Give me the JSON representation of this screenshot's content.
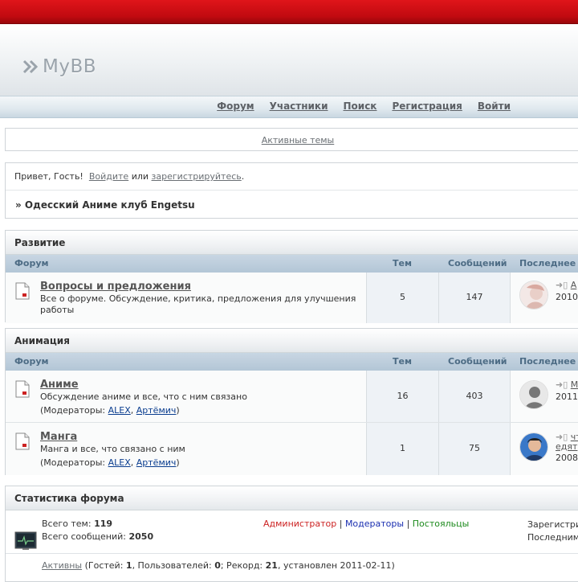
{
  "header": {
    "logo_text": "MyBB"
  },
  "menu": {
    "forum": "Форум",
    "members": "Участники",
    "search": "Поиск",
    "register": "Регистрация",
    "login": "Войти"
  },
  "active_threads": "Активные темы",
  "welcome": {
    "greeting": "Привет, Гость!",
    "login_link": "Войдите",
    "or": "или",
    "register_link": "зарегистрируйтесь",
    "period": ".",
    "breadcrumb": "» Одесский Аниме клуб Engetsu"
  },
  "columns": {
    "forum": "Форум",
    "threads": "Тем",
    "posts": "Сообщений",
    "last": "Последнее"
  },
  "categories": [
    {
      "name": "Развитие",
      "forums": [
        {
          "title": "Вопросы и предложения",
          "desc": "Все о форуме. Обсуждение, критика, предложения для улучшения работы",
          "threads": "5",
          "posts": "147",
          "last_title": "А",
          "last_date": "2010"
        }
      ]
    },
    {
      "name": "Анимация",
      "forums": [
        {
          "title": "Аниме",
          "desc": "Обсуждение аниме и все, что с ним связано",
          "mods_label": "(Модераторы:",
          "mod1": "ALEX",
          "mod2": "Артёмич",
          "threads": "16",
          "posts": "403",
          "last_title": "М",
          "last_date": "2011"
        },
        {
          "title": "Манга",
          "desc": "Манга и все, что связано с ним",
          "mods_label": "(Модераторы:",
          "mod1": "ALEX",
          "mod2": "Артёмич",
          "threads": "1",
          "posts": "75",
          "last_title": "чт",
          "last_title2": "едят",
          "last_date": "2008"
        }
      ]
    }
  ],
  "stats": {
    "title": "Статистика форума",
    "threads_label": "Всего тем:",
    "threads_value": "119",
    "posts_label": "Всего сообщений:",
    "posts_value": "2050",
    "group_admin": "Администратор",
    "group_mod": "Модераторы",
    "group_regular": "Постояльцы",
    "separator": "|",
    "right_line1": "Зарегистри",
    "right_line2": "Последним",
    "online_link": "Активны",
    "online_text1": "(Гостей:",
    "guests": "1",
    "online_text2": ", Пользователей:",
    "users": "0",
    "online_text3": "; Рекорд:",
    "record": "21",
    "online_text4": ", установлен 2011-02-11)"
  }
}
